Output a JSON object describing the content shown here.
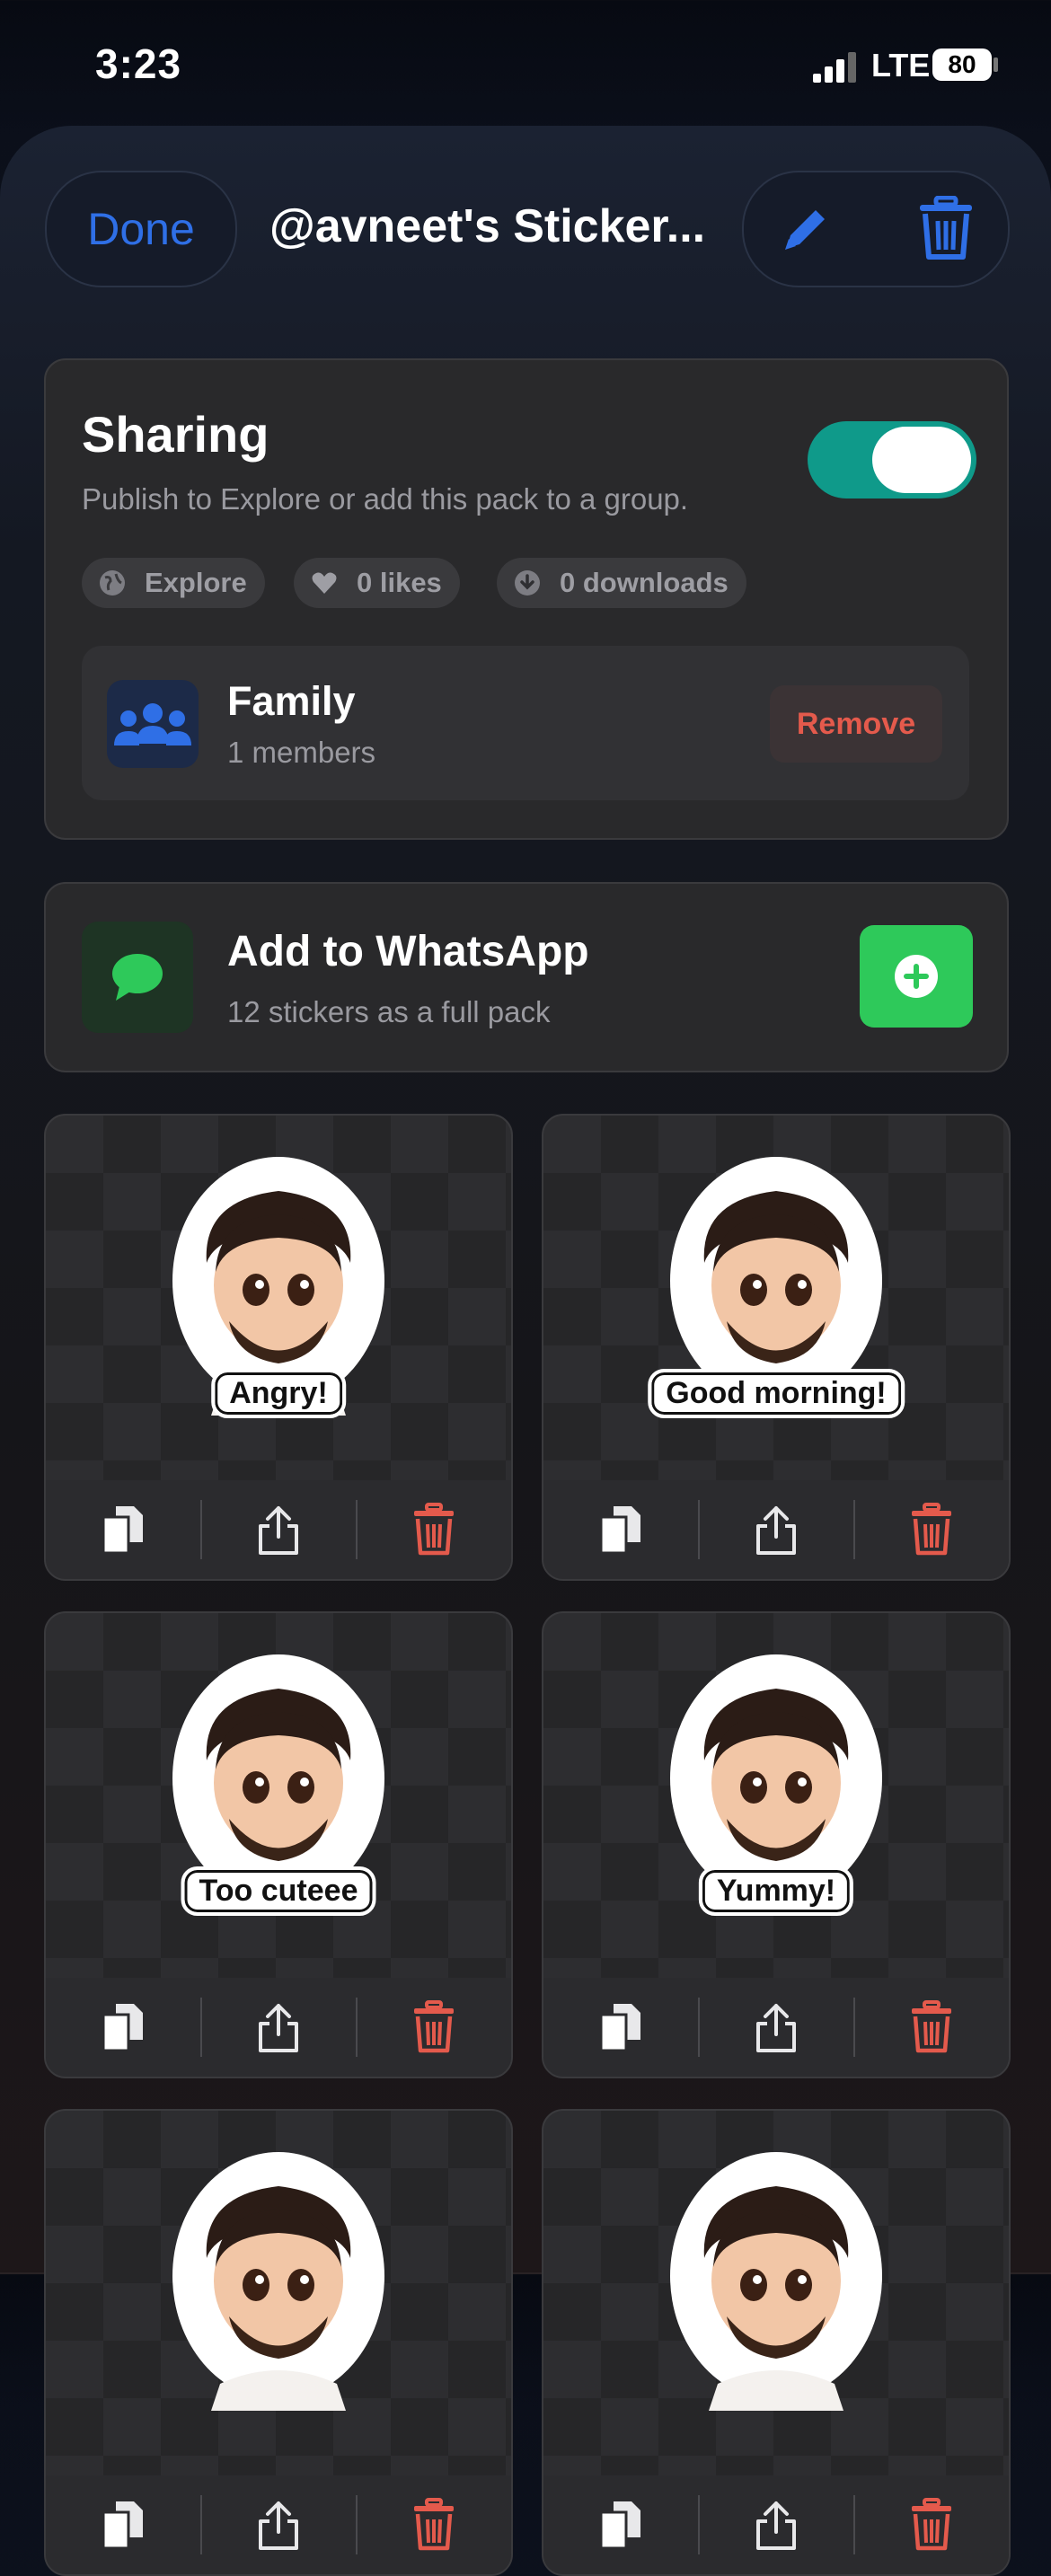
{
  "status_bar": {
    "time": "3:23",
    "network": "LTE",
    "battery": "80"
  },
  "header": {
    "done_label": "Done",
    "title": "@avneet's Sticker..."
  },
  "sharing": {
    "title": "Sharing",
    "subtitle": "Publish to Explore or add this pack to a group.",
    "toggle_on": true,
    "chips": [
      {
        "icon": "globe-icon",
        "label": "Explore"
      },
      {
        "icon": "heart-icon",
        "label": "0 likes"
      },
      {
        "icon": "download-icon",
        "label": "0 downloads"
      }
    ],
    "group": {
      "name": "Family",
      "members": "1 members",
      "remove_label": "Remove"
    }
  },
  "whatsapp": {
    "title": "Add to WhatsApp",
    "subtitle": "12 stickers as a full pack"
  },
  "stickers": [
    {
      "caption": "Angry!"
    },
    {
      "caption": "Good morning!"
    },
    {
      "caption": "Too cuteee"
    },
    {
      "caption": "Yummy!"
    },
    {
      "caption": ""
    },
    {
      "caption": ""
    }
  ],
  "colors": {
    "accent": "#2f6fe6",
    "toggle": "#0f9a8a",
    "danger": "#e45a4c",
    "whatsapp": "#2ec95a"
  }
}
